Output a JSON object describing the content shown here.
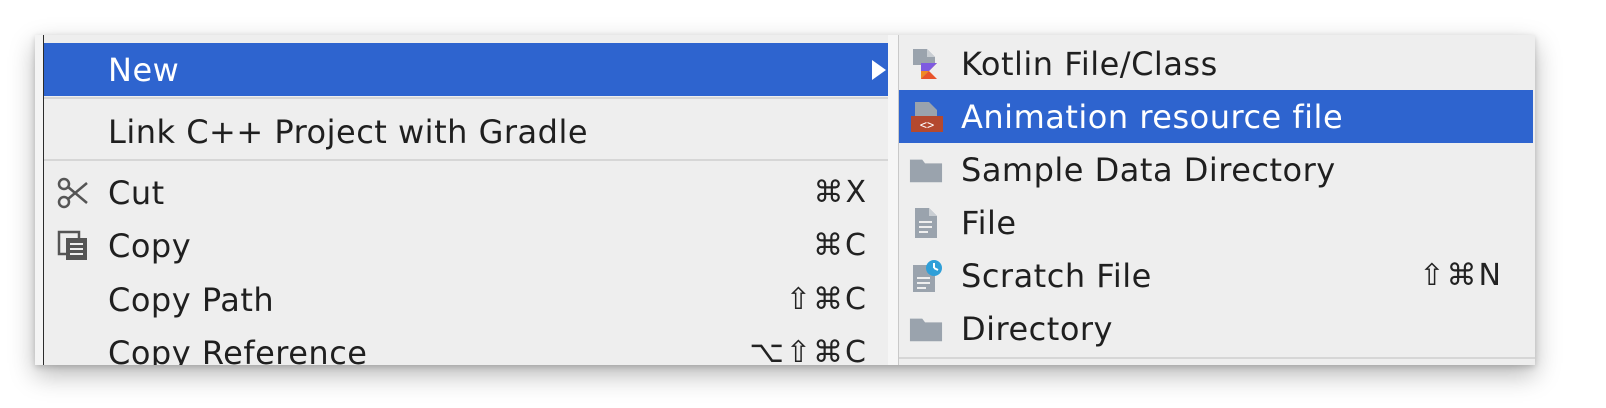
{
  "context_menu": {
    "items": [
      {
        "label": "New",
        "shortcut": "",
        "icon": "",
        "selected": true,
        "has_submenu": true
      },
      {
        "label": "Link C++ Project with Gradle",
        "shortcut": "",
        "icon": ""
      },
      {
        "label": "Cut",
        "shortcut": "⌘X",
        "icon": "scissors-icon"
      },
      {
        "label": "Copy",
        "shortcut": "⌘C",
        "icon": "copy-icon"
      },
      {
        "label": "Copy Path",
        "shortcut": "⇧⌘C",
        "icon": ""
      },
      {
        "label": "Copy Reference",
        "shortcut": "⌥⇧⌘C",
        "icon": ""
      }
    ]
  },
  "submenu": {
    "items": [
      {
        "label": "Kotlin File/Class",
        "shortcut": "",
        "icon": "kotlin-file-icon"
      },
      {
        "label": "Animation resource file",
        "shortcut": "",
        "icon": "xml-resource-icon",
        "selected": true
      },
      {
        "label": "Sample Data Directory",
        "shortcut": "",
        "icon": "folder-icon"
      },
      {
        "label": "File",
        "shortcut": "",
        "icon": "file-icon"
      },
      {
        "label": "Scratch File",
        "shortcut": "⇧⌘N",
        "icon": "scratch-file-icon"
      },
      {
        "label": "Directory",
        "shortcut": "",
        "icon": "folder-icon"
      }
    ]
  },
  "colors": {
    "selection": "#2e64cf",
    "menu_background": "#eeeeee",
    "text": "#1f1f1f"
  }
}
